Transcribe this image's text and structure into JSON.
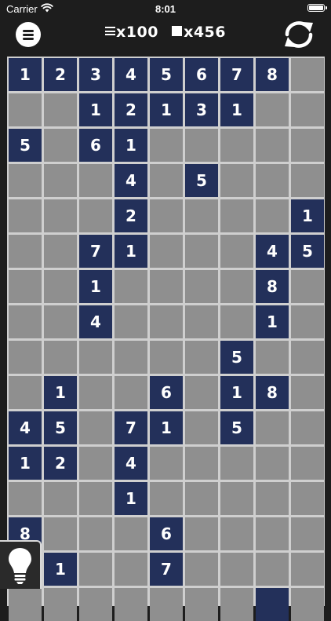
{
  "status_bar": {
    "carrier": "Carrier",
    "time": "8:01"
  },
  "header": {
    "menu_icon": "hamburger-menu-icon",
    "lines_count": "x100",
    "blocks_count": "x456",
    "refresh_icon": "refresh-icon"
  },
  "board": {
    "columns": 9,
    "visible_rows": 16,
    "colors": {
      "filled": "#23305a",
      "empty": "#8f8f8f",
      "grid": "#cfcfcf"
    },
    "rows": [
      [
        "1",
        "2",
        "3",
        "4",
        "5",
        "6",
        "7",
        "8",
        null
      ],
      [
        null,
        null,
        "1",
        "2",
        "1",
        "3",
        "1",
        null,
        null
      ],
      [
        "5",
        null,
        "6",
        "1",
        null,
        null,
        null,
        null,
        null
      ],
      [
        null,
        null,
        null,
        "4",
        null,
        "5",
        null,
        null,
        null
      ],
      [
        null,
        null,
        null,
        "2",
        null,
        null,
        null,
        null,
        "1"
      ],
      [
        null,
        null,
        "7",
        "1",
        null,
        null,
        null,
        "4",
        "5"
      ],
      [
        null,
        null,
        "1",
        null,
        null,
        null,
        null,
        "8",
        null
      ],
      [
        null,
        null,
        "4",
        null,
        null,
        null,
        null,
        "1",
        null
      ],
      [
        null,
        null,
        null,
        null,
        null,
        null,
        "5",
        null,
        null
      ],
      [
        null,
        "1",
        null,
        null,
        "6",
        null,
        "1",
        "8",
        null
      ],
      [
        "4",
        "5",
        null,
        "7",
        "1",
        null,
        "5",
        null,
        null
      ],
      [
        "1",
        "2",
        null,
        "4",
        null,
        null,
        null,
        null,
        null
      ],
      [
        null,
        null,
        null,
        "1",
        null,
        null,
        null,
        null,
        null
      ],
      [
        "8",
        null,
        null,
        null,
        "6",
        null,
        null,
        null,
        null
      ],
      [
        null,
        "1",
        null,
        null,
        "7",
        null,
        null,
        null,
        null
      ],
      [
        null,
        null,
        null,
        null,
        null,
        null,
        null,
        "",
        null
      ]
    ]
  },
  "hint": {
    "icon": "lightbulb-icon"
  }
}
